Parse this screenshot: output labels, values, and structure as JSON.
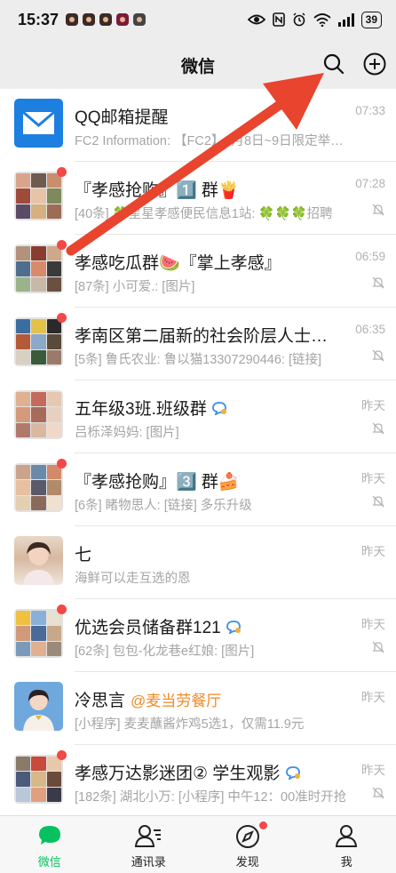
{
  "status_bar": {
    "time": "15:37",
    "battery": "39",
    "app_icons": [
      "app-icon",
      "app-icon",
      "app-icon",
      "app-icon",
      "app-icon"
    ],
    "indicators": [
      "eye-icon",
      "nfc-icon",
      "alarm-icon",
      "wifi-icon",
      "signal-icon"
    ]
  },
  "header": {
    "title": "微信"
  },
  "chats": [
    {
      "name": "QQ邮箱提醒",
      "message": "FC2 Information: 【FC2】8月8日~9日限定举…",
      "time": "07:33",
      "muted": false,
      "dot": false
    },
    {
      "name": "『孝感抢购』1️⃣ 群🍟",
      "message": "[40条] 🍀星星孝感便民信息1站: 🍀🍀🍀招聘",
      "time": "07:28",
      "muted": true,
      "dot": true
    },
    {
      "name": "孝感吃瓜群🍉『掌上孝感』",
      "message": "[87条] 小可爱.: [图片]",
      "time": "06:59",
      "muted": true,
      "dot": true
    },
    {
      "name": "孝南区第二届新的社会阶层人士…",
      "message": "[5条] 鲁氏农业: 鲁以猫13307290446: [链接]",
      "time": "06:35",
      "muted": true,
      "dot": true
    },
    {
      "name": "五年级3班.班级群",
      "message": "吕栎泽妈妈: [图片]",
      "time": "昨天",
      "muted": true,
      "dot": false
    },
    {
      "name": "『孝感抢购』3️⃣ 群🍰",
      "message": "[6条] 睹物思人: [链接] 多乐升级",
      "time": "昨天",
      "muted": true,
      "dot": true
    },
    {
      "name": "七",
      "message": "海鲜可以走互选的恩",
      "time": "昨天",
      "muted": false,
      "dot": false
    },
    {
      "name": "优选会员储备群121",
      "message": "[62条] 包包-化龙巷e红娘: [图片]",
      "time": "昨天",
      "muted": true,
      "dot": true
    },
    {
      "name": "冷思言",
      "tag": "@麦当劳餐厅",
      "message": "[小程序] 麦麦蘸酱炸鸡5选1，仅需11.9元",
      "time": "昨天",
      "muted": false,
      "dot": false
    },
    {
      "name": "孝感万达影迷团② 学生观影",
      "message": "[182条] 湖北小万: [小程序] 中午12：00准时开抢",
      "time": "昨天",
      "muted": true,
      "dot": true
    }
  ],
  "tabs": [
    {
      "label": "微信",
      "icon": "chat-bubble-icon",
      "active": true
    },
    {
      "label": "通讯录",
      "icon": "contacts-icon",
      "active": false
    },
    {
      "label": "发现",
      "icon": "compass-icon",
      "active": false,
      "dot": true
    },
    {
      "label": "我",
      "icon": "person-icon",
      "active": false
    }
  ],
  "colors": {
    "accent": "#07c160",
    "unread_dot": "#f24848",
    "annotation_arrow": "#e8442e"
  }
}
